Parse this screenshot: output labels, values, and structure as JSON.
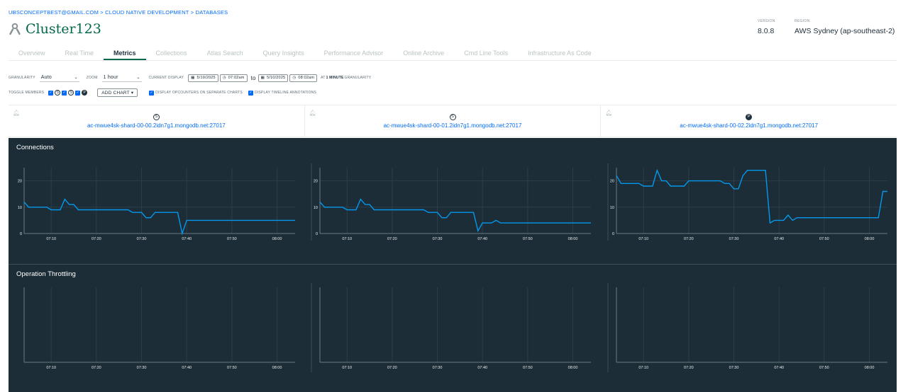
{
  "breadcrumb": "UBSCONCEPTBEST@GMAIL.COM > CLOUD NATIVE DEVELOPMENT > DATABASES",
  "cluster": {
    "title": "Cluster123",
    "icon": "cluster-icon"
  },
  "version": {
    "label": "VERSION",
    "value": "8.0.8"
  },
  "region": {
    "label": "REGION",
    "value": "AWS Sydney (ap-southeast-2)"
  },
  "tabs": [
    {
      "label": "Overview",
      "active": false
    },
    {
      "label": "Real Time",
      "active": false
    },
    {
      "label": "Metrics",
      "active": true
    },
    {
      "label": "Collections",
      "active": false
    },
    {
      "label": "Atlas Search",
      "active": false
    },
    {
      "label": "Query Insights",
      "active": false
    },
    {
      "label": "Performance Advisor",
      "active": false
    },
    {
      "label": "Online Archive",
      "active": false
    },
    {
      "label": "Cmd Line Tools",
      "active": false
    },
    {
      "label": "Infrastructure As Code",
      "active": false
    }
  ],
  "controls": {
    "granularity_label": "GRANULARITY",
    "granularity_value": "Auto",
    "zoom_label": "ZOOM",
    "zoom_value": "1 hour",
    "current_display_label": "CURRENT DISPLAY",
    "start_date": "5/10/2025",
    "start_time": "07:02am",
    "to_label": "to",
    "end_date": "5/10/2025",
    "end_time": "08:02am",
    "granularity_note_prefix": "AT",
    "granularity_note_value": "1 MINUTE",
    "granularity_note_suffix": "GRANULARITY",
    "toggle_members_label": "TOGGLE MEMBERS",
    "members": [
      "S",
      "S",
      "P"
    ],
    "add_chart": "ADD CHART ▾",
    "opt_separate": "DISPLAY OPCOUNTERS ON SEPARATE CHARTS",
    "opt_annotations": "DISPLAY TIMELINE ANNOTATIONS"
  },
  "hosts": [
    {
      "role": "S",
      "name": "ac-mwue4sk-shard-00-00.2idn7g1.mongodb.net:27017"
    },
    {
      "role": "S",
      "name": "ac-mwue4sk-shard-00-01.2idn7g1.mongodb.net:27017"
    },
    {
      "role": "P",
      "name": "ac-mwue4sk-shard-00-02.2idn7g1.mongodb.net:27017"
    }
  ],
  "sections": {
    "connections": "Connections",
    "throttling": "Operation Throttling"
  },
  "colors": {
    "line": "#0498ec",
    "background": "#1c2d38",
    "link": "#016bf8",
    "accent": "#00684a"
  },
  "chart_data": [
    {
      "type": "line",
      "title": "Connections",
      "x_ticks": [
        "07:10",
        "07:20",
        "07:30",
        "07:40",
        "07:50",
        "08:00"
      ],
      "y_ticks": [
        0,
        10,
        20
      ],
      "xlim": [
        2,
        62
      ],
      "ylim": [
        0,
        25
      ],
      "series": [
        {
          "host": 0,
          "points": [
            [
              2,
              12
            ],
            [
              3,
              10
            ],
            [
              7,
              10
            ],
            [
              8,
              9
            ],
            [
              10,
              9
            ],
            [
              11,
              13
            ],
            [
              12,
              11
            ],
            [
              13,
              11
            ],
            [
              14,
              9
            ],
            [
              25,
              9
            ],
            [
              26,
              8
            ],
            [
              28,
              8
            ],
            [
              29,
              6
            ],
            [
              30,
              6
            ],
            [
              31,
              8
            ],
            [
              36,
              8
            ],
            [
              37,
              0
            ],
            [
              38,
              5
            ],
            [
              62,
              5
            ]
          ]
        },
        {
          "host": 1,
          "points": [
            [
              2,
              12
            ],
            [
              3,
              10
            ],
            [
              7,
              10
            ],
            [
              8,
              9
            ],
            [
              10,
              9
            ],
            [
              11,
              13
            ],
            [
              12,
              11
            ],
            [
              13,
              11
            ],
            [
              14,
              9
            ],
            [
              25,
              9
            ],
            [
              26,
              8
            ],
            [
              28,
              8
            ],
            [
              29,
              6
            ],
            [
              30,
              6
            ],
            [
              31,
              8
            ],
            [
              36,
              8
            ],
            [
              37,
              1
            ],
            [
              38,
              4
            ],
            [
              40,
              4
            ],
            [
              41,
              5
            ],
            [
              42,
              4
            ],
            [
              62,
              4
            ]
          ]
        },
        {
          "host": 2,
          "points": [
            [
              2,
              22
            ],
            [
              3,
              19
            ],
            [
              7,
              19
            ],
            [
              8,
              18
            ],
            [
              10,
              18
            ],
            [
              11,
              24
            ],
            [
              12,
              20
            ],
            [
              13,
              20
            ],
            [
              14,
              18
            ],
            [
              17,
              18
            ],
            [
              18,
              20
            ],
            [
              25,
              20
            ],
            [
              26,
              19
            ],
            [
              27,
              19
            ],
            [
              28,
              17
            ],
            [
              29,
              17
            ],
            [
              30,
              22
            ],
            [
              31,
              24
            ],
            [
              35,
              24
            ],
            [
              36,
              4
            ],
            [
              37,
              5
            ],
            [
              39,
              5
            ],
            [
              40,
              7
            ],
            [
              41,
              5
            ],
            [
              42,
              6
            ],
            [
              60,
              6
            ],
            [
              61,
              16
            ],
            [
              62,
              16
            ]
          ]
        }
      ]
    },
    {
      "type": "line",
      "title": "Operation Throttling",
      "x_ticks": [
        "07:10",
        "07:20",
        "07:30",
        "07:40",
        "07:50",
        "08:00"
      ],
      "xlim": [
        2,
        62
      ],
      "series": []
    }
  ]
}
